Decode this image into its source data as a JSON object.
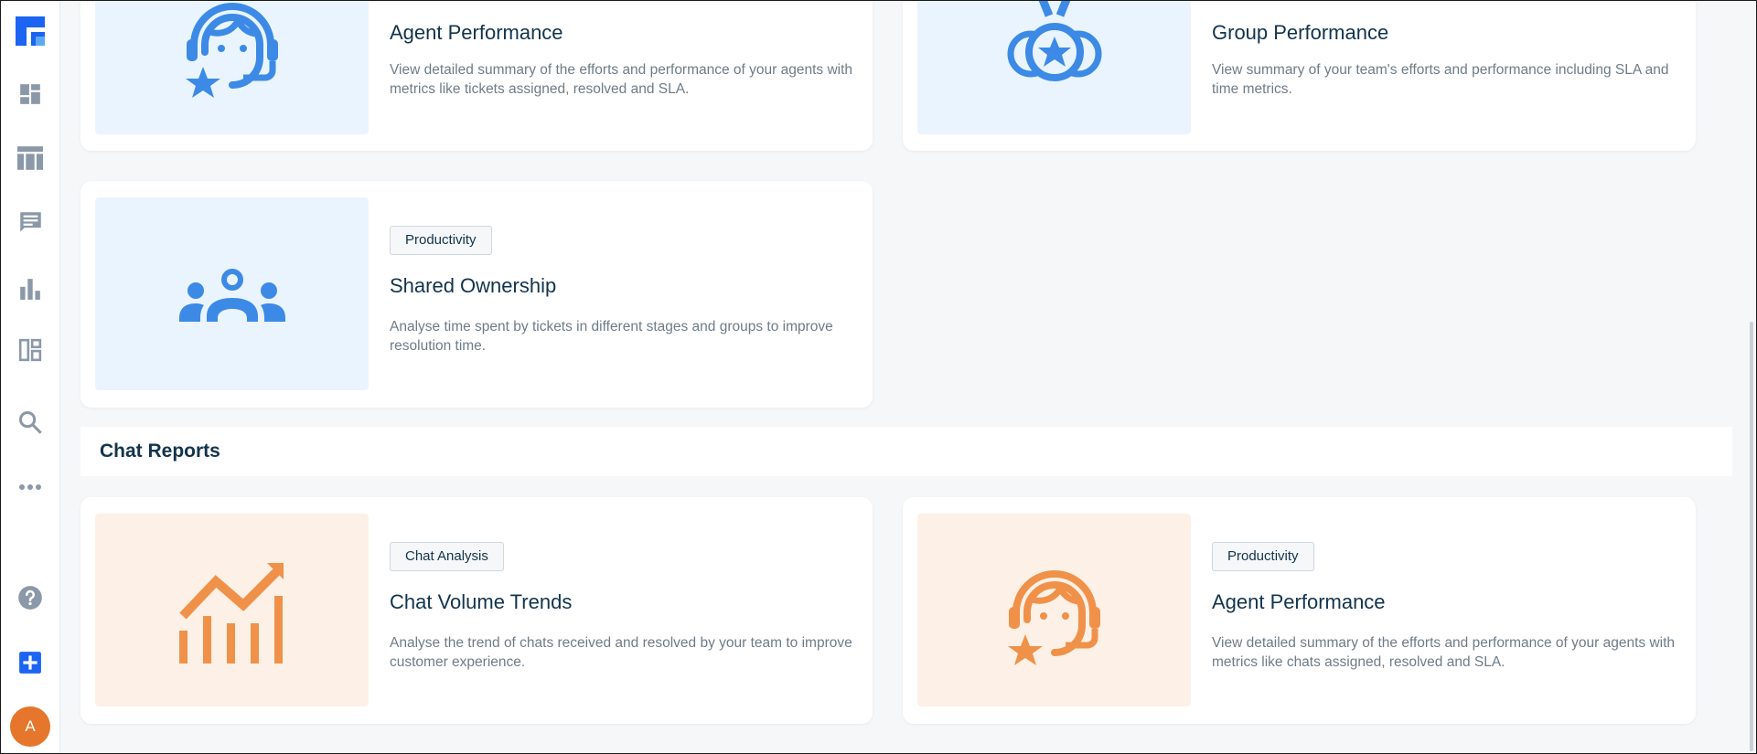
{
  "sidebar": {
    "items": [
      {
        "icon": "freshdesk-logo-icon"
      },
      {
        "icon": "dashboard-icon"
      },
      {
        "icon": "tickets-table-icon"
      },
      {
        "icon": "conversations-icon"
      },
      {
        "icon": "analytics-bar-chart-icon"
      },
      {
        "icon": "layout-panels-icon"
      },
      {
        "icon": "search-icon"
      },
      {
        "icon": "more-dots-icon"
      },
      {
        "icon": "help-question-icon"
      },
      {
        "icon": "add-new-icon"
      }
    ],
    "avatar_letter": "A",
    "avatar_color": "#e5762b",
    "brand_color": "#1c64f2"
  },
  "ticket_reports": {
    "cards": [
      {
        "title": "Agent Performance",
        "description": "View detailed summary of the efforts and performance of your agents with metrics like tickets assigned, resolved and SLA.",
        "icon": "agent-headset-icon",
        "theme": "blue"
      },
      {
        "title": "Group Performance",
        "description": "View summary of your team's efforts and performance including SLA and time metrics.",
        "icon": "medal-icon",
        "theme": "blue"
      },
      {
        "tag": "Productivity",
        "title": "Shared Ownership",
        "description": "Analyse time spent by tickets in different stages and groups to improve resolution time.",
        "icon": "group-people-icon",
        "theme": "blue"
      }
    ]
  },
  "chat_reports": {
    "title": "Chat Reports",
    "cards": [
      {
        "tag": "Chat Analysis",
        "title": "Chat Volume Trends",
        "description": "Analyse the trend of chats received and resolved by your team to improve customer experience.",
        "icon": "trend-chart-icon",
        "theme": "orange"
      },
      {
        "tag": "Productivity",
        "title": "Agent Performance",
        "description": "View detailed summary of the efforts and performance of your agents with metrics like chats assigned, resolved and SLA.",
        "icon": "agent-headset-icon",
        "theme": "orange"
      }
    ]
  },
  "colors": {
    "blue_icon": "#3c8ae6",
    "blue_bg": "#eaf4fe",
    "orange_icon": "#f0914a",
    "orange_bg": "#fdf0e6",
    "sidebar_icon": "#8a98a8"
  }
}
